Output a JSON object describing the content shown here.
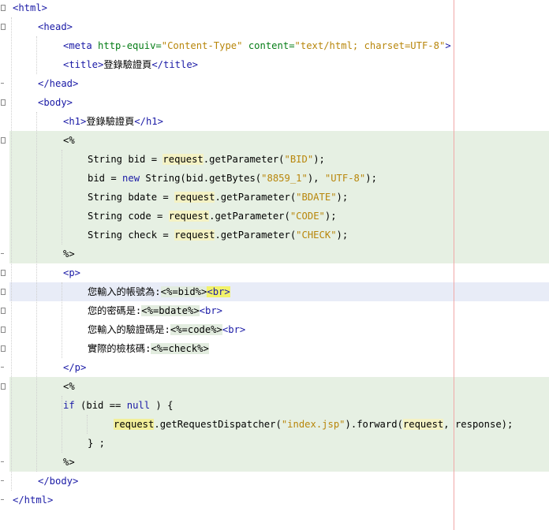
{
  "lines": {
    "l1": "<html>",
    "l2": "<head>",
    "l3_tag": "<meta",
    "l3_attr1": "http-equiv=",
    "l3_val1": "\"Content-Type\"",
    "l3_attr2": "content=",
    "l3_val2": "\"text/html; charset=UTF-8\"",
    "l3_end": ">",
    "l4_open": "<title>",
    "l4_text": "登錄驗證頁",
    "l4_close": "</title>",
    "l5": "</head>",
    "l6": "<body>",
    "l7_open": "<h1>",
    "l7_text": "登錄驗證頁",
    "l7_close": "</h1>",
    "l8": "<%",
    "l9_a": "String bid = ",
    "l9_req": "request",
    "l9_b": ".getParameter(",
    "l9_str": "\"BID\"",
    "l9_c": ");",
    "l10_a": "bid = ",
    "l10_new": "new",
    "l10_b": " String(bid.getBytes(",
    "l10_str1": "\"8859_1\"",
    "l10_c": "), ",
    "l10_str2": "\"UTF-8\"",
    "l10_d": ");",
    "l11_a": "String bdate = ",
    "l11_req": "request",
    "l11_b": ".getParameter(",
    "l11_str": "\"BDATE\"",
    "l11_c": ");",
    "l12_a": "String code = ",
    "l12_req": "request",
    "l12_b": ".getParameter(",
    "l12_str": "\"CODE\"",
    "l12_c": ");",
    "l13_a": "String check = ",
    "l13_req": "request",
    "l13_b": ".getParameter(",
    "l13_str": "\"CHECK\"",
    "l13_c": ");",
    "l14": "%>",
    "l15": "<p>",
    "l16_text": "您輸入的帳號為:",
    "l16_expr": "<%=bid%>",
    "l16_br": "<br>",
    "l17_text": "您的密碼是:",
    "l17_expr": "<%=bdate%>",
    "l17_br": "<br>",
    "l18_text": "您輸入的驗證碼是:",
    "l18_expr": "<%=code%>",
    "l18_br": "<br>",
    "l19_text": "實際的檢核碼:",
    "l19_expr": "<%=check%>",
    "l20": "</p>",
    "l21": "<%",
    "l22_if": "if",
    "l22_a": " (bid == ",
    "l22_null": "null",
    "l22_b": " ) {",
    "l23_req1": "request",
    "l23_a": ".getRequestDispatcher(",
    "l23_str": "\"index.jsp\"",
    "l23_b": ").forward(",
    "l23_req2": "request",
    "l23_c": ", response);",
    "l24": "} ;",
    "l25": "%>",
    "l26": "</body>",
    "l27": "</html>"
  },
  "colors": {
    "tag": "#1a1aa6",
    "attribute": "#067d17",
    "string": "#b8860b",
    "scriptlet_background": "#e6f0e3",
    "current_line": "#e8ecf7",
    "margin_line": "#f0a8a8"
  }
}
